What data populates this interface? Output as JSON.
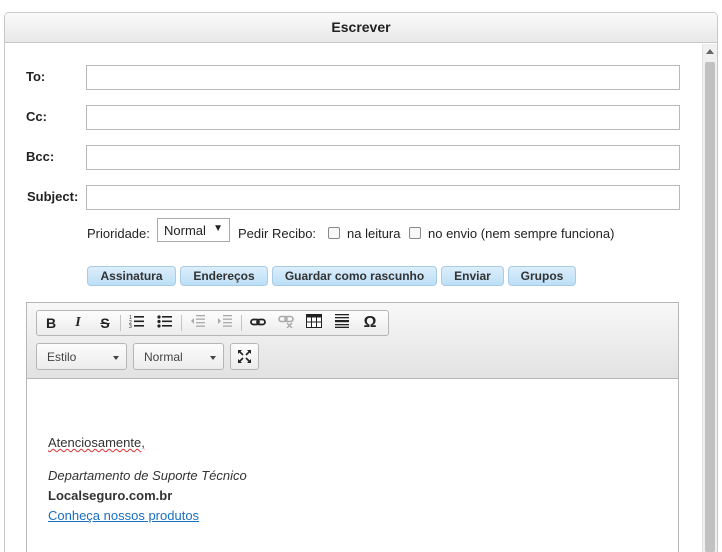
{
  "window": {
    "title": "Escrever"
  },
  "fields": {
    "to_label": "To:",
    "to_value": "",
    "cc_label": "Cc:",
    "cc_value": "",
    "bcc_label": "Bcc:",
    "bcc_value": "",
    "subject_label": "Subject:",
    "subject_value": ""
  },
  "options": {
    "priority_label": "Prioridade:",
    "priority_value": "Normal",
    "receipt_label": "Pedir Recibo:",
    "read_label": "na leitura",
    "send_label": "no envio (nem sempre funciona)"
  },
  "buttons": {
    "signature": "Assinatura",
    "addresses": "Endereços",
    "save_draft": "Guardar como rascunho",
    "send": "Enviar",
    "groups": "Grupos"
  },
  "toolbar": {
    "bold": "B",
    "italic": "I",
    "strike": "S",
    "special_char": "Ω",
    "style_combo": "Estilo",
    "format_combo": "Normal"
  },
  "body": {
    "closing": "Atenciosamente,",
    "department": "Departamento de Suporte Técnico",
    "company": "Localseguro.com.br",
    "link": "Conheça nossos produtos"
  },
  "colors": {
    "button_bg": "#bcdff7",
    "link": "#1a6fc0"
  },
  "icons": [
    "bold-icon",
    "italic-icon",
    "strikethrough-icon",
    "numbered-list-icon",
    "bullet-list-icon",
    "outdent-icon",
    "indent-icon",
    "link-icon",
    "unlink-icon",
    "table-icon",
    "horizontal-rule-icon",
    "special-char-icon",
    "maximize-icon"
  ]
}
